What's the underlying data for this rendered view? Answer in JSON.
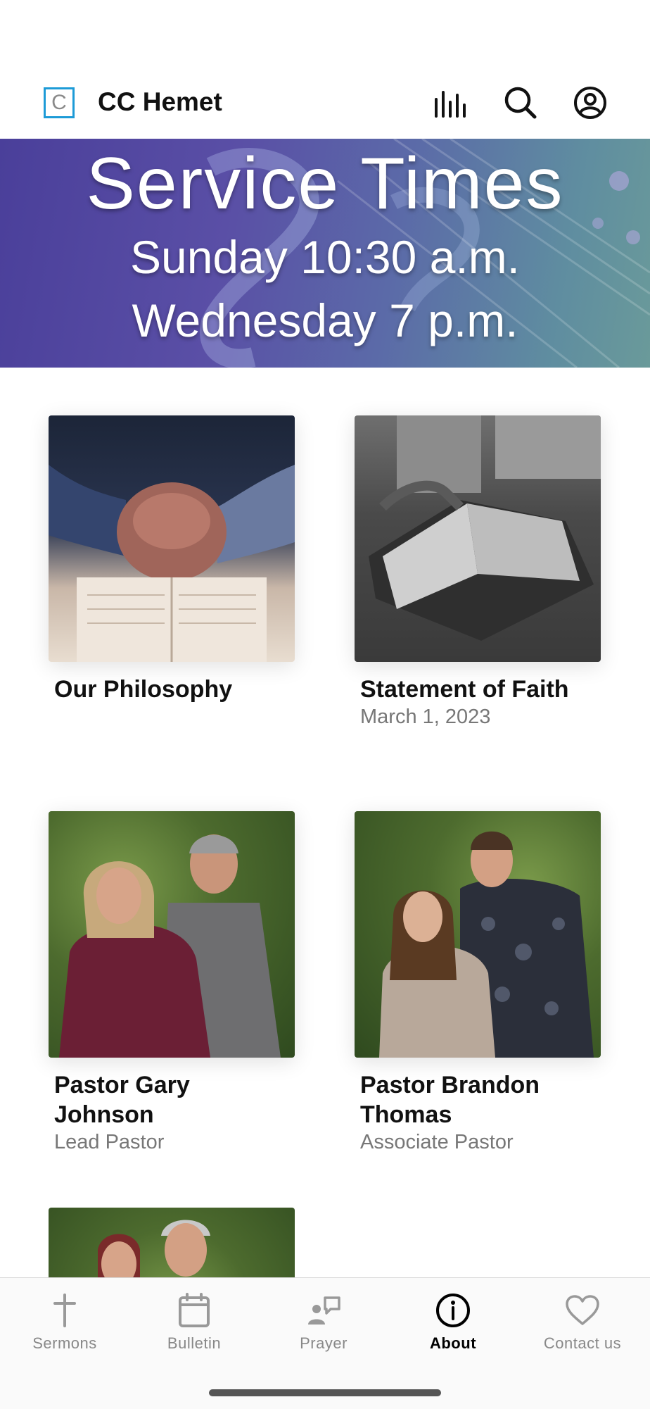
{
  "app": {
    "title": "CC Hemet",
    "logo_letter": "C"
  },
  "header_icons": [
    "equalizer-icon",
    "search-icon",
    "account-icon"
  ],
  "banner": {
    "title": "Service Times",
    "line1": "Sunday 10:30 a.m.",
    "line2": "Wednesday 7 p.m."
  },
  "cards": [
    {
      "title": "Our Philosophy",
      "subtitle": ""
    },
    {
      "title": "Statement of Faith",
      "subtitle": "March 1, 2023"
    },
    {
      "title": "Pastor Gary Johnson",
      "subtitle": "Lead Pastor"
    },
    {
      "title": "Pastor Brandon Thomas",
      "subtitle": "Associate Pastor"
    }
  ],
  "tabs": [
    {
      "label": "Sermons",
      "icon": "cross-icon",
      "active": false
    },
    {
      "label": "Bulletin",
      "icon": "calendar-icon",
      "active": false
    },
    {
      "label": "Prayer",
      "icon": "prayer-icon",
      "active": false
    },
    {
      "label": "About",
      "icon": "info-icon",
      "active": true
    },
    {
      "label": "Contact us",
      "icon": "heart-icon",
      "active": false
    }
  ],
  "colors": {
    "accent": "#1d9bd7",
    "banner_start": "#4a3f9a",
    "banner_end": "#6a9a9a"
  }
}
